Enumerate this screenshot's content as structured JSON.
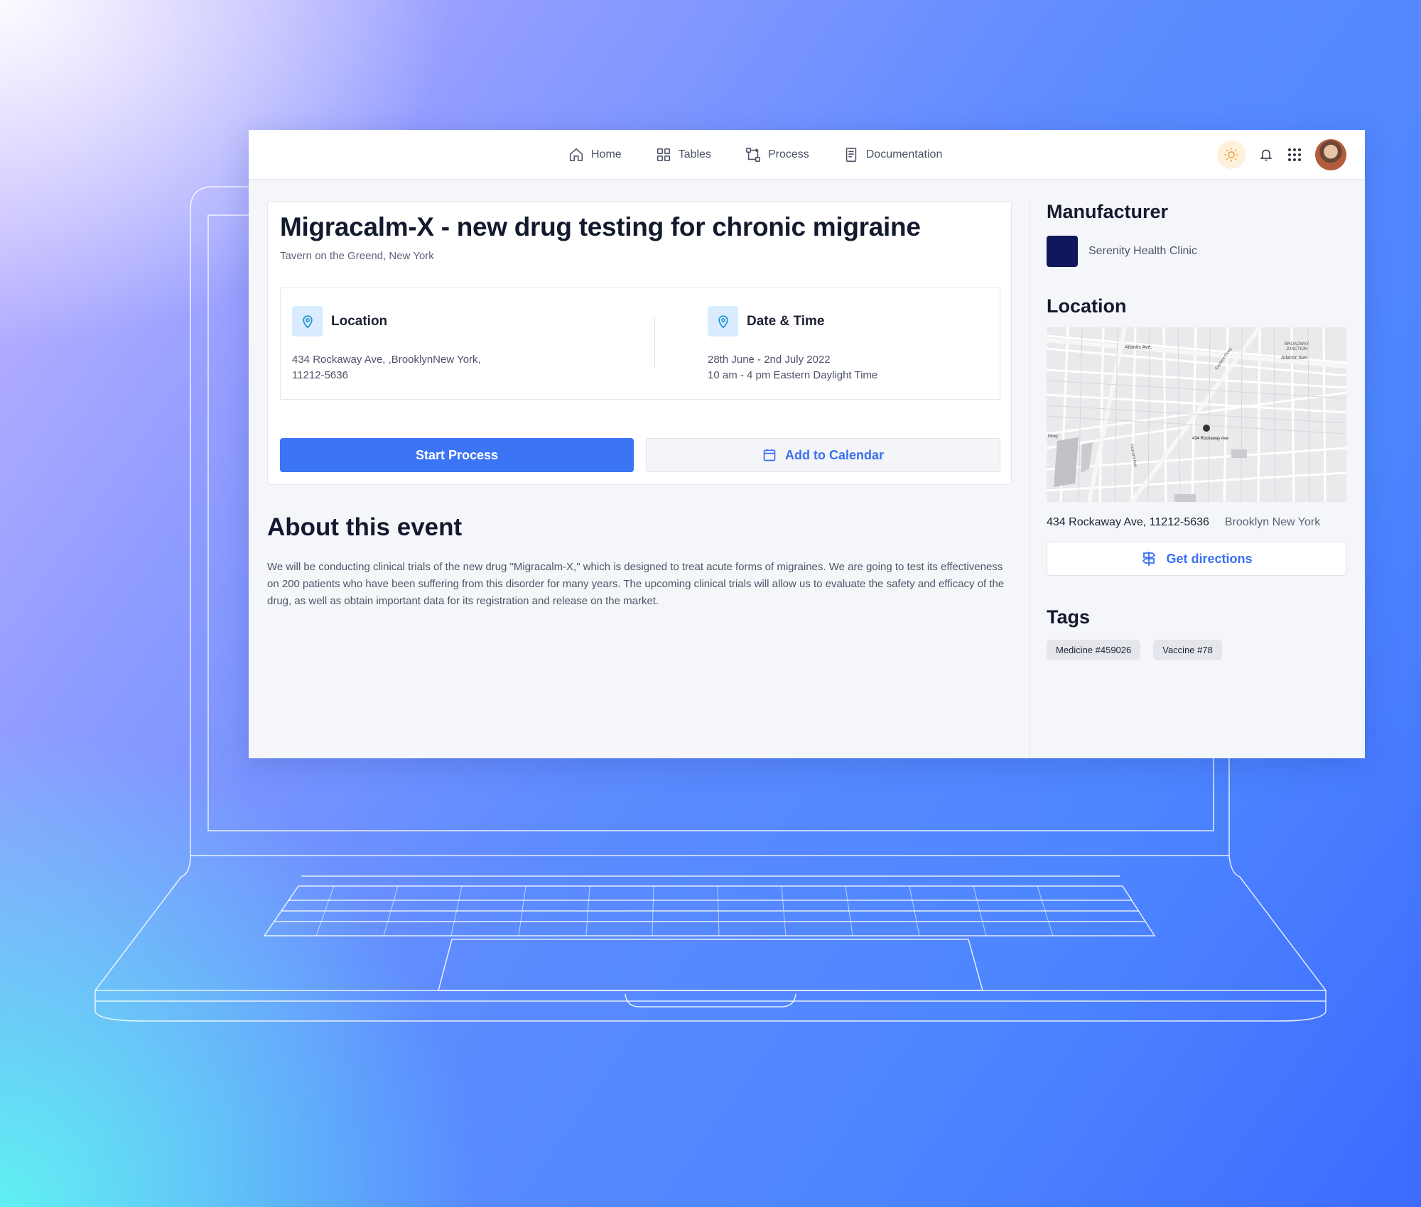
{
  "nav": {
    "items": [
      {
        "label": "Home",
        "icon": "home-icon"
      },
      {
        "label": "Tables",
        "icon": "grid-icon"
      },
      {
        "label": "Process",
        "icon": "process-icon"
      },
      {
        "label": "Documentation",
        "icon": "document-icon"
      }
    ]
  },
  "event": {
    "title": "Migracalm-X - new drug testing for chronic migraine",
    "venue": "Tavern on the Greend, New York",
    "location": {
      "label": "Location",
      "line1": "434 Rockaway Ave, ,BrooklynNew York,",
      "line2": "11212-5636"
    },
    "datetime": {
      "label": "Date & Time",
      "line1": "28th June - 2nd July 2022",
      "line2": "10 am - 4 pm Eastern Daylight Time"
    },
    "start_button": "Start Process",
    "calendar_button": "Add to Calendar"
  },
  "about": {
    "title": "About this event",
    "text": "We will be conducting clinical trials of the new drug \"Migracalm-X,\" which is designed to treat acute forms of migraines. We are going to test its effectiveness on 200 patients who have been suffering from this disorder for many years. The upcoming clinical trials will allow us to evaluate the safety and efficacy of the drug, as well as obtain important data for its registration and release on the market."
  },
  "side": {
    "manufacturer_title": "Manufacturer",
    "manufacturer_name": "Serenity Health Clinic",
    "location_title": "Location",
    "address": "434 Rockaway Ave, 11212-5636",
    "city": "Brooklyn New York",
    "directions_button": "Get directions",
    "tags_title": "Tags",
    "tags": [
      "Medicine #459026",
      "Vaccine #78"
    ]
  },
  "map_labels": {
    "atlantic1": "Atlantic Ave.",
    "atlantic2": "Atlantic Ave.",
    "marker": "434 Rockaway Ave",
    "broadway": "BROADWAY",
    "junction": "JUNCTION",
    "eastern": "Eastern Pkwy",
    "howard": "Howard Ave",
    "pkwy": "Pkwy"
  },
  "colors": {
    "primary": "#3b74f5",
    "link": "#3b6ff0",
    "manufacturer_logo": "#10175a",
    "pin_bg": "#d9ecff"
  }
}
